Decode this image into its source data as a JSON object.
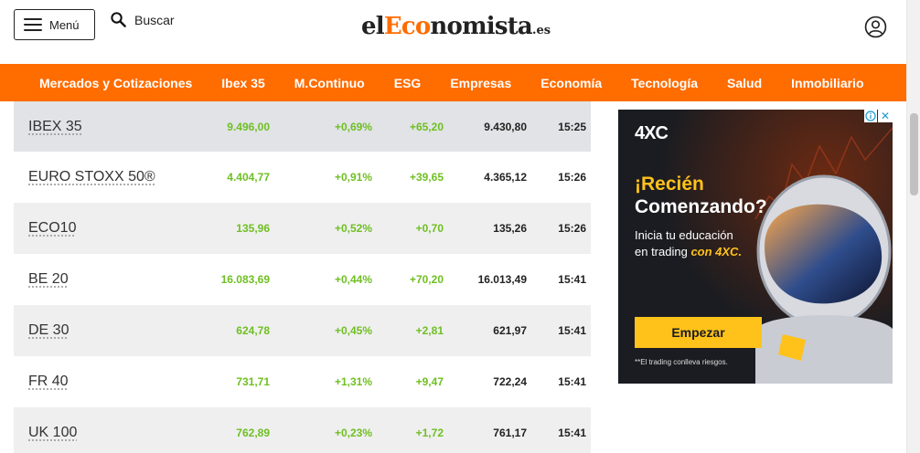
{
  "header": {
    "menu_label": "Menú",
    "search_label": "Buscar",
    "logo": {
      "prefix": "el",
      "accent": "Eco",
      "rest": "nomista",
      "tld": ".es"
    }
  },
  "nav": {
    "items": [
      "Mercados y Cotizaciones",
      "Ibex 35",
      "M.Continuo",
      "ESG",
      "Empresas",
      "Economía",
      "Tecnología",
      "Salud",
      "Inmobiliario"
    ]
  },
  "table": {
    "rows": [
      {
        "name": "IBEX 35",
        "price": "9.496,00",
        "pct": "+0,69%",
        "pts": "+65,20",
        "prev": "9.430,80",
        "time": "15:25"
      },
      {
        "name": "EURO STOXX 50®",
        "price": "4.404,77",
        "pct": "+0,91%",
        "pts": "+39,65",
        "prev": "4.365,12",
        "time": "15:26"
      },
      {
        "name": "ECO10",
        "price": "135,96",
        "pct": "+0,52%",
        "pts": "+0,70",
        "prev": "135,26",
        "time": "15:26"
      },
      {
        "name": "BE 20",
        "price": "16.083,69",
        "pct": "+0,44%",
        "pts": "+70,20",
        "prev": "16.013,49",
        "time": "15:41"
      },
      {
        "name": "DE 30",
        "price": "624,78",
        "pct": "+0,45%",
        "pts": "+2,81",
        "prev": "621,97",
        "time": "15:41"
      },
      {
        "name": "FR 40",
        "price": "731,71",
        "pct": "+1,31%",
        "pts": "+9,47",
        "prev": "722,24",
        "time": "15:41"
      },
      {
        "name": "UK 100",
        "price": "762,89",
        "pct": "+0,23%",
        "pts": "+1,72",
        "prev": "761,17",
        "time": "15:41"
      }
    ]
  },
  "ad": {
    "brand": "4XC",
    "headline_1": "¡Recién",
    "headline_2": "Comenzando?",
    "line_1": "Inicia tu educación",
    "line_2_prefix": "en trading ",
    "line_2_highlight": "con 4XC.",
    "cta": "Empezar",
    "disclaimer": "**El trading conlleva riesgos."
  },
  "colors": {
    "brand_orange": "#ff6c00",
    "positive_green": "#6fbf22",
    "ad_yellow": "#ffc21a"
  }
}
